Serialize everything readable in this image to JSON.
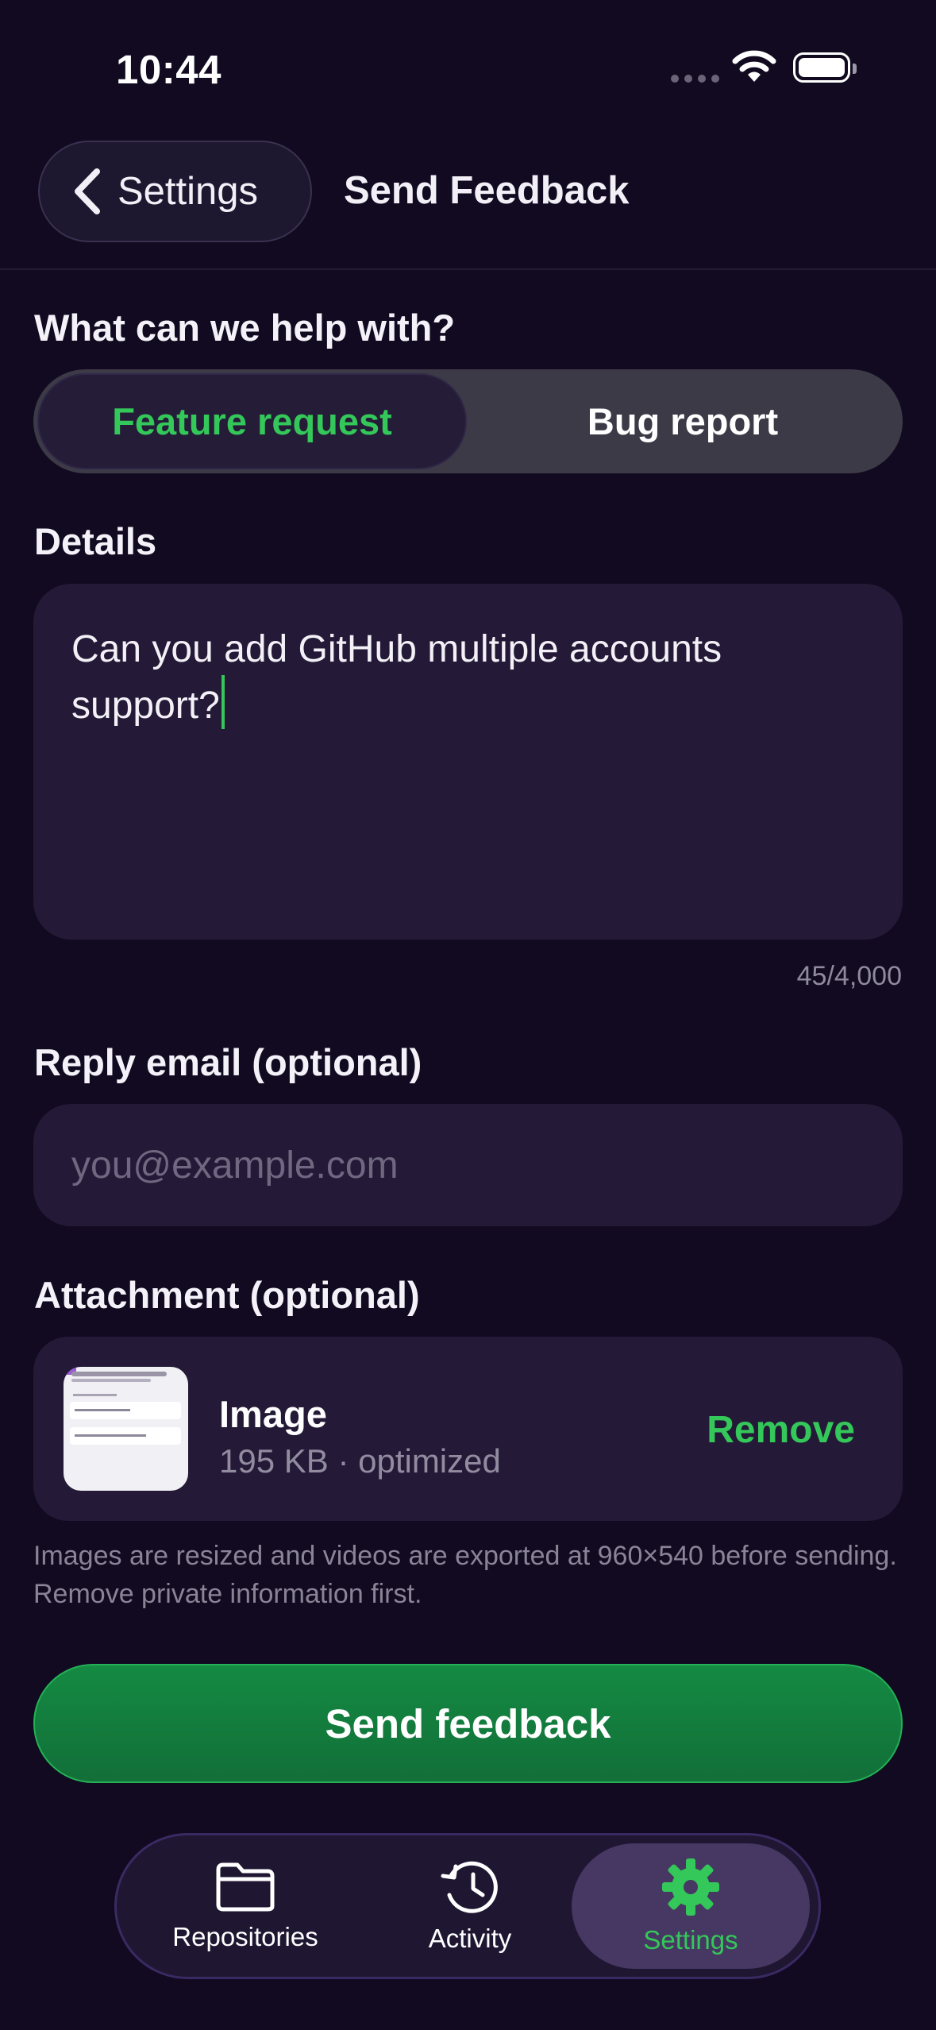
{
  "status_bar": {
    "time": "10:44"
  },
  "nav": {
    "back_label": "Settings",
    "title": "Send Feedback"
  },
  "form": {
    "help_label": "What can we help with?",
    "segments": [
      "Feature request",
      "Bug report"
    ],
    "selected_segment": "Feature request",
    "details_label": "Details",
    "details_value": "Can you add GitHub multiple accounts support?",
    "char_count": "45/4,000",
    "email_label": "Reply email (optional)",
    "email_placeholder": "you@example.com",
    "attachment_label": "Attachment (optional)",
    "attachment": {
      "title": "Image",
      "subtitle": "195 KB · optimized",
      "remove_label": "Remove"
    },
    "hint": "Images are resized and videos are exported at 960×540 before sending. Remove private information first.",
    "submit_label": "Send feedback"
  },
  "tabbar": {
    "items": [
      {
        "label": "Repositories",
        "icon": "folder-icon"
      },
      {
        "label": "Activity",
        "icon": "history-icon"
      },
      {
        "label": "Settings",
        "icon": "gear-icon"
      }
    ],
    "active": "Settings"
  },
  "colors": {
    "background": "#110a21",
    "accent": "#34c759",
    "card": "#241a37",
    "button": "#137e3d"
  }
}
